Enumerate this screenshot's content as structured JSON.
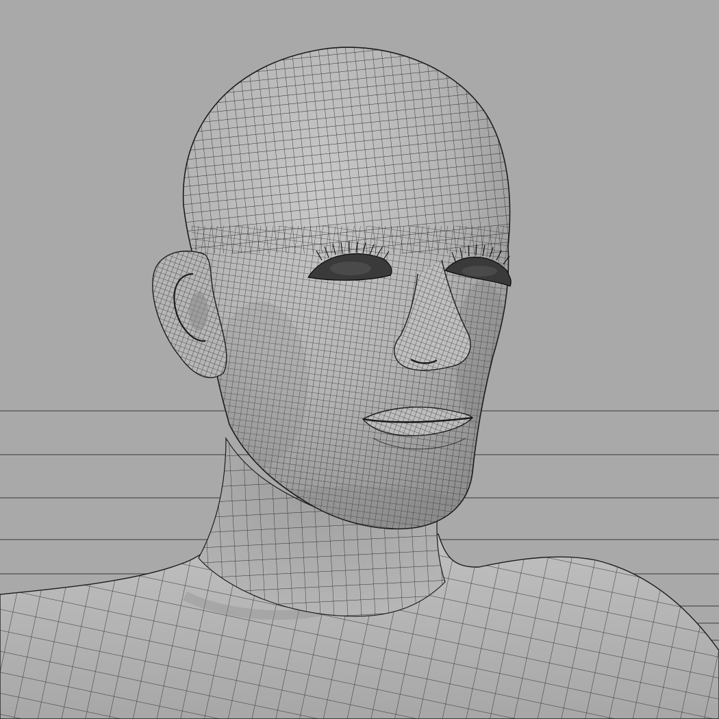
{
  "scene": {
    "subject": "wireframe-head-bust",
    "render_style": "clay-wireframe",
    "colors": {
      "background": "#a9a9a9",
      "floor_lines": "#4e4e4e",
      "skin_light": "#c4c4c4",
      "skin_mid": "#b0b0b0",
      "skin_shadow": "#8e8e8e",
      "wire": "#1b1b1b",
      "lashes": "#0a0a0a"
    }
  }
}
